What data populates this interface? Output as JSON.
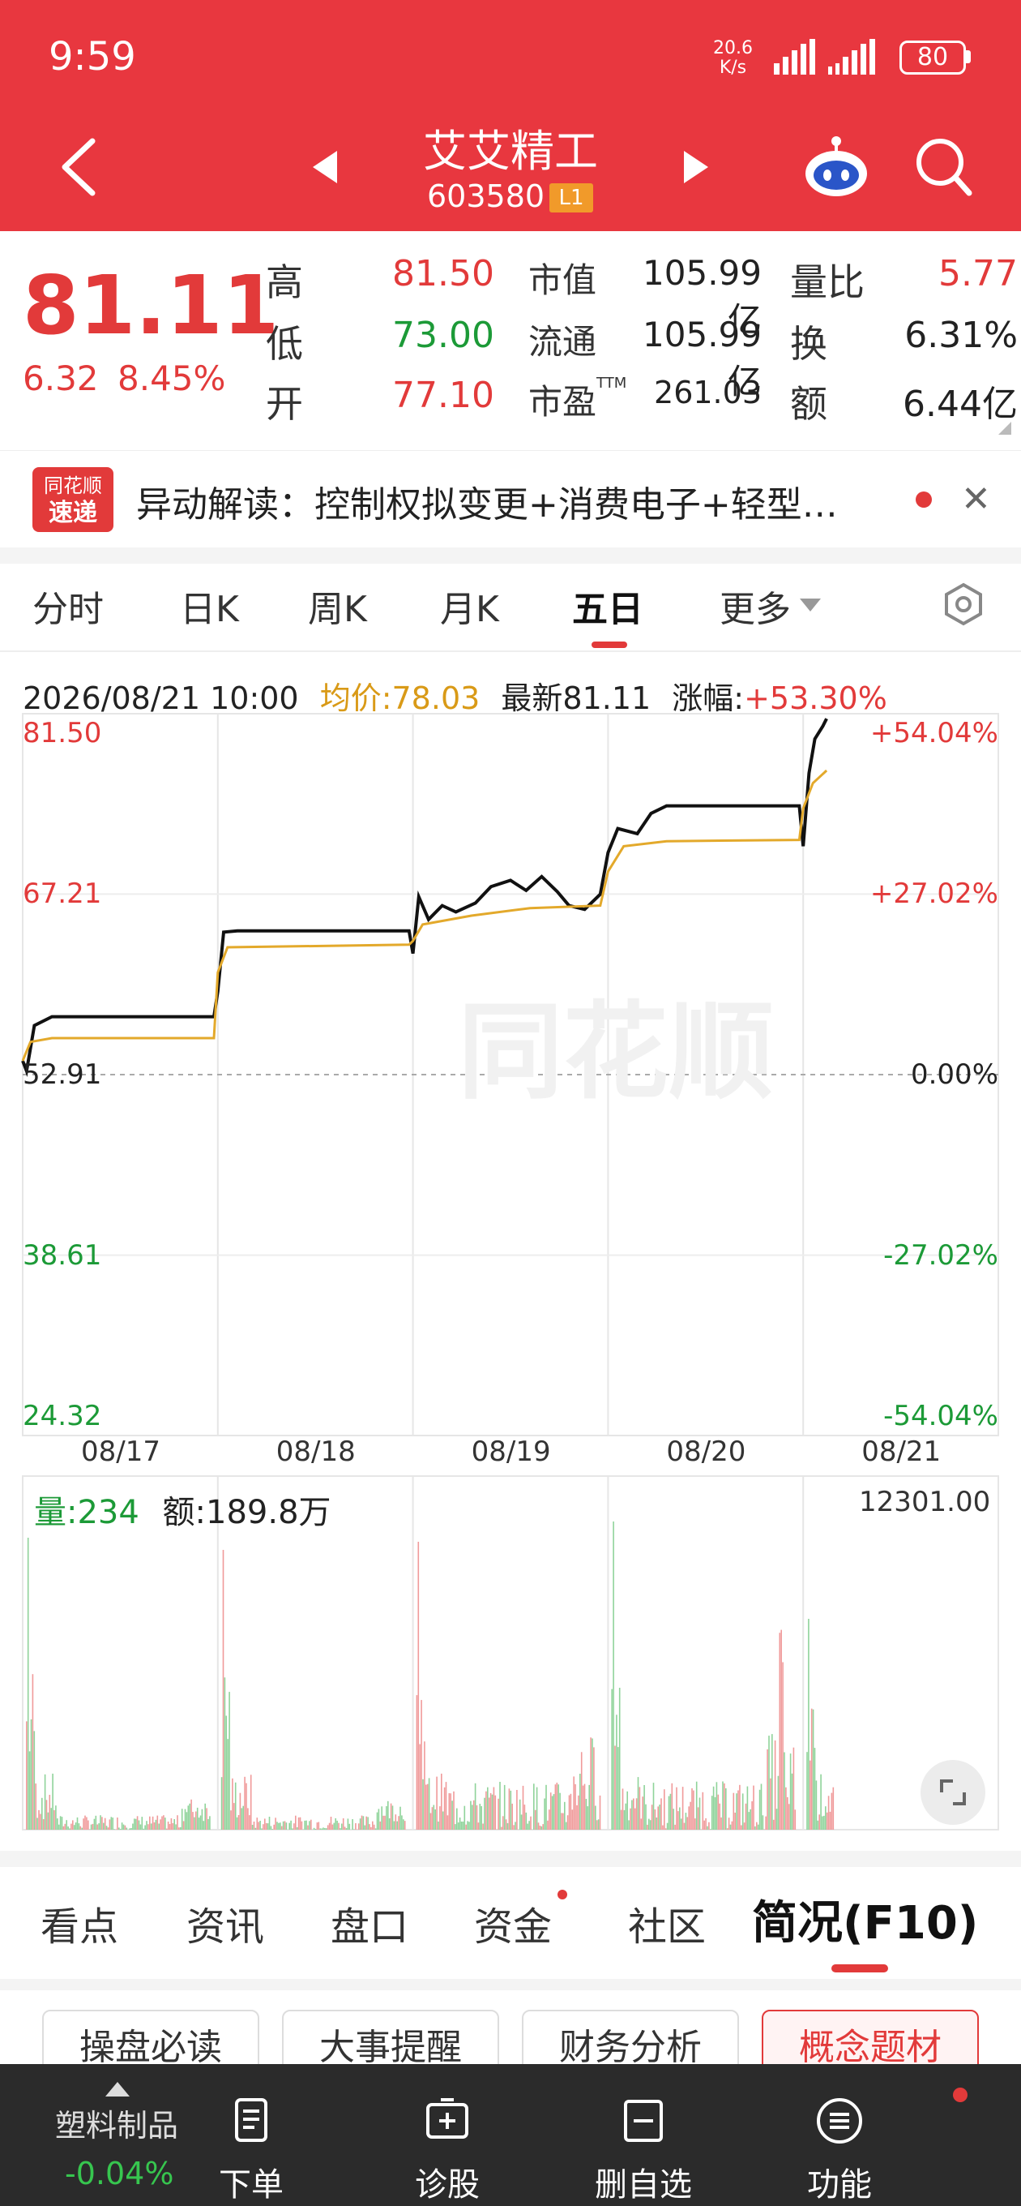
{
  "status_bar": {
    "time": "9:59",
    "net_speed_value": "20.6",
    "net_speed_unit": "K/s",
    "battery": "80"
  },
  "header": {
    "stock_name": "艾艾精工",
    "stock_code": "603580",
    "level_badge": "L1",
    "icons": [
      "back-arrow-icon",
      "prev-stock-icon",
      "next-stock-icon",
      "robot-assistant-icon",
      "search-icon"
    ]
  },
  "quote": {
    "price": "81.11",
    "change": "6.32",
    "change_pct": "8.45%",
    "rows": [
      {
        "l1": "高",
        "v1": "81.50",
        "c1": "red",
        "l2": "市值",
        "v2": "105.99亿",
        "l3": "量比",
        "v3": "5.77",
        "c3": "red"
      },
      {
        "l1": "低",
        "v1": "73.00",
        "c1": "green",
        "l2": "流通",
        "v2": "105.99亿",
        "l3": "换",
        "v3": "6.31%",
        "c3": "dark"
      },
      {
        "l1": "开",
        "v1": "77.10",
        "c1": "red",
        "l2": "市盈TTM",
        "v2": "261.03",
        "l3": "额",
        "v3": "6.44亿",
        "c3": "dark"
      }
    ]
  },
  "news": {
    "logo_line1": "同花顺",
    "logo_line2": "速递",
    "text": "异动解读：控制权拟变更+消费电子+轻型…"
  },
  "chart_tabs": {
    "items": [
      "分时",
      "日K",
      "周K",
      "月K",
      "五日",
      "更多"
    ],
    "active": "五日"
  },
  "info_line": {
    "datetime": "2026/08/21 10:00",
    "avg_label": "均价:78.03",
    "latest_label": "最新81.11",
    "chg_label": "涨幅:",
    "chg_value": "+53.30%"
  },
  "chart_data": {
    "type": "line",
    "y_left_ticks": [
      "81.50",
      "67.21",
      "52.91",
      "38.61",
      "24.32"
    ],
    "y_right_ticks": [
      "+54.04%",
      "+27.02%",
      "0.00%",
      "-27.02%",
      "-54.04%"
    ],
    "x_ticks": [
      "08/17",
      "08/18",
      "08/19",
      "08/20",
      "08/21"
    ],
    "ylim": [
      24.32,
      81.5
    ],
    "baseline": 52.91,
    "series": [
      {
        "name": "最新",
        "color": "#111111",
        "values": [
          [
            0,
            54.0
          ],
          [
            0.02,
            53.2
          ],
          [
            0.06,
            56.8
          ],
          [
            0.15,
            57.5
          ],
          [
            0.98,
            57.5
          ],
          [
            1.0,
            59.5
          ],
          [
            1.03,
            64.2
          ],
          [
            1.1,
            64.3
          ],
          [
            1.98,
            64.3
          ],
          [
            2.0,
            62.5
          ],
          [
            2.03,
            67.0
          ],
          [
            2.08,
            65.2
          ],
          [
            2.15,
            66.3
          ],
          [
            2.22,
            65.8
          ],
          [
            2.32,
            66.5
          ],
          [
            2.4,
            67.8
          ],
          [
            2.5,
            68.3
          ],
          [
            2.58,
            67.5
          ],
          [
            2.66,
            68.6
          ],
          [
            2.74,
            67.4
          ],
          [
            2.8,
            66.3
          ],
          [
            2.88,
            66.0
          ],
          [
            2.96,
            67.2
          ],
          [
            3.0,
            70.5
          ],
          [
            3.05,
            72.4
          ],
          [
            3.15,
            72.0
          ],
          [
            3.22,
            73.6
          ],
          [
            3.3,
            74.2
          ],
          [
            3.98,
            74.2
          ],
          [
            4.0,
            71.0
          ],
          [
            4.03,
            76.8
          ],
          [
            4.06,
            79.5
          ],
          [
            4.1,
            80.5
          ],
          [
            4.12,
            81.11
          ]
        ]
      },
      {
        "name": "均价",
        "color": "#e3a92b",
        "values": [
          [
            0,
            54.0
          ],
          [
            0.04,
            55.5
          ],
          [
            0.15,
            55.8
          ],
          [
            0.98,
            55.8
          ],
          [
            1.0,
            61.0
          ],
          [
            1.05,
            63.0
          ],
          [
            1.98,
            63.2
          ],
          [
            2.0,
            63.5
          ],
          [
            2.05,
            64.8
          ],
          [
            2.3,
            65.5
          ],
          [
            2.6,
            66.1
          ],
          [
            2.96,
            66.3
          ],
          [
            3.0,
            69.0
          ],
          [
            3.08,
            71.0
          ],
          [
            3.3,
            71.4
          ],
          [
            3.98,
            71.5
          ],
          [
            4.0,
            74.0
          ],
          [
            4.05,
            76.0
          ],
          [
            4.12,
            77.0
          ]
        ]
      }
    ]
  },
  "volume": {
    "vol_label": "量:234",
    "amt_label": "额:189.8万",
    "max_label": "12301.00",
    "expand_icon": "fullscreen-icon"
  },
  "sub_tabs": {
    "items": [
      "看点",
      "资讯",
      "盘口",
      "资金",
      "社区",
      "简况(F10)"
    ],
    "active": "简况(F10)"
  },
  "pills": {
    "items": [
      "操盘必读",
      "大事提醒",
      "财务分析",
      "概念题材"
    ],
    "active": "概念题材"
  },
  "bottom_bar": {
    "sector_name": "塑料制品",
    "sector_chg": "-0.04%",
    "items": [
      {
        "label": "下单",
        "icon": "order-icon"
      },
      {
        "label": "诊股",
        "icon": "diagnose-icon"
      },
      {
        "label": "删自选",
        "icon": "remove-watchlist-icon"
      },
      {
        "label": "功能",
        "icon": "menu-icon"
      }
    ]
  },
  "watermark": "同花顺"
}
